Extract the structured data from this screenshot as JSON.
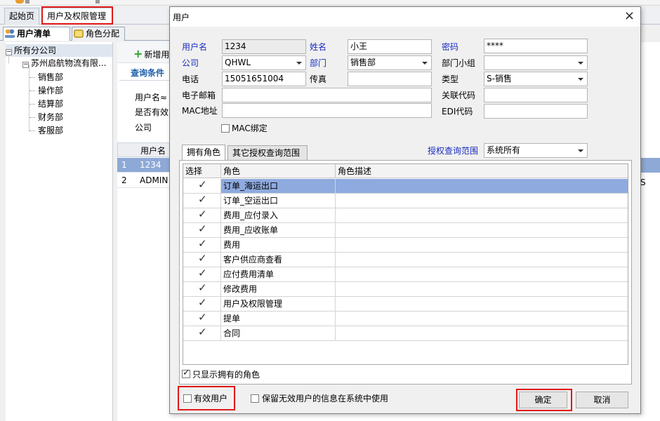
{
  "app": {
    "page_tabs": [
      "起始页",
      "用户及权限管理"
    ],
    "sub_tabs": [
      {
        "label": "用户清单",
        "icon": "users-icon"
      },
      {
        "label": "角色分配",
        "icon": "lock-icon"
      }
    ],
    "tree": {
      "root": "所有分公司",
      "company": "苏州启航物流有限...",
      "departments": [
        "销售部",
        "操作部",
        "结算部",
        "财务部",
        "客服部"
      ]
    },
    "toolbar": {
      "add_label": "新增用"
    },
    "query": {
      "title": "查询条件",
      "labels": [
        "用户名≈",
        "是否有效",
        "公司"
      ]
    },
    "bg_grid": {
      "header": "用户名",
      "rows": [
        {
          "n": "1",
          "v": "1234"
        },
        {
          "n": "2",
          "v": "ADMIN"
        }
      ],
      "right_fragment": "S"
    }
  },
  "dialog": {
    "title": "用户",
    "close_glyph": "×",
    "fields": {
      "username": {
        "label": "用户名",
        "value": "1234"
      },
      "name": {
        "label": "姓名",
        "value": "小王"
      },
      "password": {
        "label": "密码",
        "value": "****"
      },
      "company": {
        "label": "公司",
        "value": "QHWL"
      },
      "department": {
        "label": "部门",
        "value": "销售部"
      },
      "dept_group": {
        "label": "部门小组",
        "value": ""
      },
      "phone": {
        "label": "电话",
        "value": "15051651004"
      },
      "fax": {
        "label": "传真",
        "value": ""
      },
      "type": {
        "label": "类型",
        "value": "S-销售"
      },
      "email": {
        "label": "电子邮箱",
        "value": ""
      },
      "related_code": {
        "label": "关联代码",
        "value": ""
      },
      "mac": {
        "label": "MAC地址",
        "value": ""
      },
      "edi": {
        "label": "EDI代码",
        "value": ""
      },
      "mac_bind": {
        "label": "MAC绑定",
        "checked": false
      }
    },
    "tabs": [
      "拥有角色",
      "其它授权查询范围"
    ],
    "scope": {
      "label": "授权查询范围",
      "value": "系统所有"
    },
    "grid": {
      "headers": [
        "选择",
        "角色",
        "角色描述"
      ],
      "rows": [
        {
          "role": "订单_海运出口",
          "desc": "",
          "checked": true,
          "selected": true
        },
        {
          "role": "订单_空运出口",
          "desc": "",
          "checked": true,
          "selected": false
        },
        {
          "role": "费用_应付录入",
          "desc": "",
          "checked": true,
          "selected": false
        },
        {
          "role": "费用_应收账单",
          "desc": "",
          "checked": true,
          "selected": false
        },
        {
          "role": "费用",
          "desc": "",
          "checked": true,
          "selected": false
        },
        {
          "role": "客户供应商查看",
          "desc": "",
          "checked": true,
          "selected": false
        },
        {
          "role": "应付费用清单",
          "desc": "",
          "checked": true,
          "selected": false
        },
        {
          "role": "修改费用",
          "desc": "",
          "checked": true,
          "selected": false
        },
        {
          "role": "用户及权限管理",
          "desc": "",
          "checked": true,
          "selected": false
        },
        {
          "role": "提单",
          "desc": "",
          "checked": true,
          "selected": false
        },
        {
          "role": "合同",
          "desc": "",
          "checked": true,
          "selected": false
        }
      ]
    },
    "only_owned": {
      "label": "只显示拥有的角色",
      "checked": true
    },
    "valid_user": {
      "label": "有效用户",
      "checked": false
    },
    "keep_invalid": {
      "label": "保留无效用户的信息在系统中使用",
      "checked": false
    },
    "ok_label": "确定",
    "cancel_label": "取消"
  },
  "colors": {
    "highlight_red": "#e01818",
    "row_selected": "#8eaadf",
    "label_blue": "#1a2dbf"
  }
}
